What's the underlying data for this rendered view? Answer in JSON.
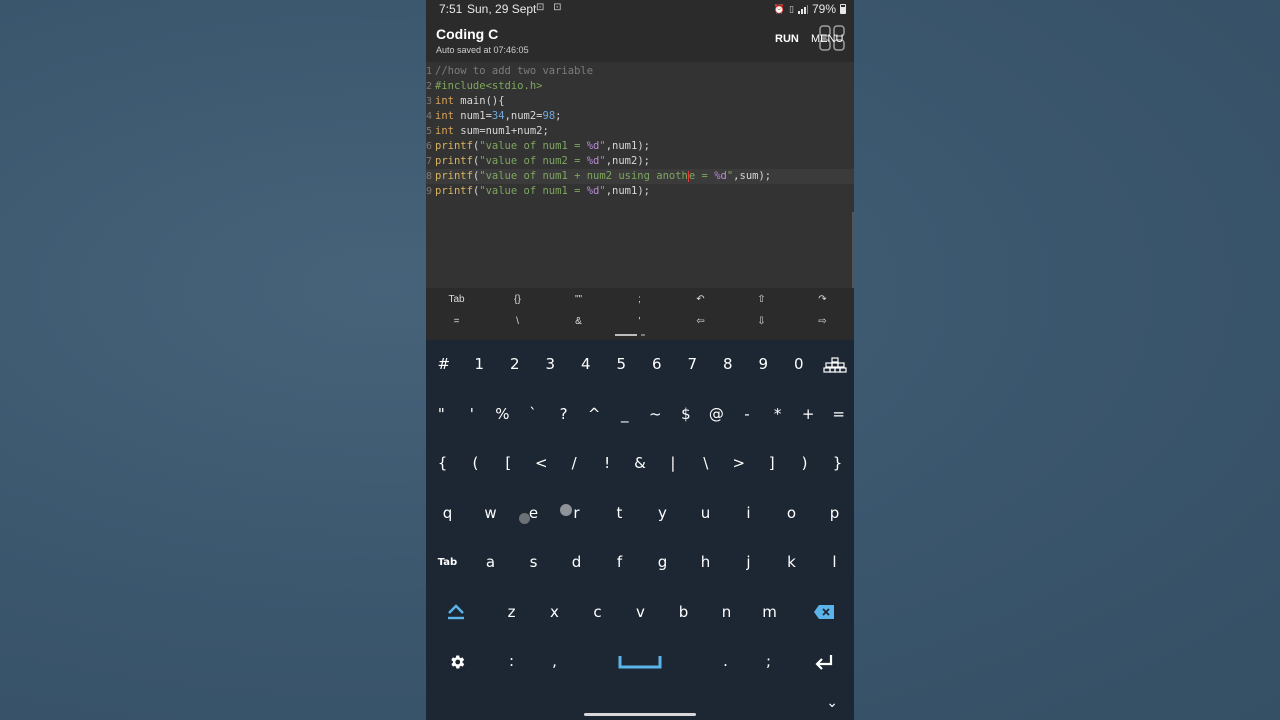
{
  "status_bar": {
    "time": "7:51",
    "date": "Sun, 29 Sept",
    "left_icons": "⊡ ⊡",
    "battery": "79%"
  },
  "app_bar": {
    "title": "Coding C",
    "subtitle": "Auto saved at 07:46:05",
    "run_label": "RUN",
    "menu_label": "MENU"
  },
  "editor": {
    "line_numbers": [
      "1",
      "2",
      "3",
      "4",
      "5",
      "6",
      "7",
      "8",
      "9"
    ],
    "lines": [
      [
        {
          "t": "//how to add two variable",
          "c": "comment"
        }
      ],
      [
        {
          "t": "#include<stdio.h>",
          "c": "pre"
        }
      ],
      [
        {
          "t": "int",
          "c": "kw"
        },
        {
          "t": " main(){",
          "c": "plain"
        }
      ],
      [
        {
          "t": "int",
          "c": "kw"
        },
        {
          "t": " num1=",
          "c": "plain"
        },
        {
          "t": "34",
          "c": "num"
        },
        {
          "t": ",num2=",
          "c": "plain"
        },
        {
          "t": "98",
          "c": "num"
        },
        {
          "t": ";",
          "c": "plain"
        }
      ],
      [
        {
          "t": "int",
          "c": "kw"
        },
        {
          "t": " sum=num1+num2;",
          "c": "plain"
        }
      ],
      [
        {
          "t": "printf",
          "c": "fn"
        },
        {
          "t": "(",
          "c": "plain"
        },
        {
          "t": "\"value of num1 = ",
          "c": "str"
        },
        {
          "t": "%d",
          "c": "fmt"
        },
        {
          "t": "\"",
          "c": "str"
        },
        {
          "t": ",num1);",
          "c": "plain"
        }
      ],
      [
        {
          "t": "printf",
          "c": "fn"
        },
        {
          "t": "(",
          "c": "plain"
        },
        {
          "t": "\"value of num2 = ",
          "c": "str"
        },
        {
          "t": "%d",
          "c": "fmt"
        },
        {
          "t": "\"",
          "c": "str"
        },
        {
          "t": ",num2);",
          "c": "plain"
        }
      ],
      [
        {
          "t": "printf",
          "c": "fn"
        },
        {
          "t": "(",
          "c": "plain"
        },
        {
          "t": "\"value of num1 + num2 using anoth",
          "c": "str"
        },
        {
          "t": "|",
          "c": "cursor"
        },
        {
          "t": "e = ",
          "c": "str"
        },
        {
          "t": "%d",
          "c": "fmt"
        },
        {
          "t": "\"",
          "c": "str"
        },
        {
          "t": ",sum);",
          "c": "plain"
        }
      ],
      [
        {
          "t": "printf",
          "c": "fn"
        },
        {
          "t": "(",
          "c": "plain"
        },
        {
          "t": "\"value of num1 = ",
          "c": "str"
        },
        {
          "t": "%d",
          "c": "fmt"
        },
        {
          "t": "\"",
          "c": "str"
        },
        {
          "t": ",num1);",
          "c": "plain"
        }
      ]
    ],
    "active_line": 8
  },
  "extra_keys": {
    "row1": [
      "Tab",
      "{}",
      "\"\"",
      ";",
      "↶",
      "⇧",
      "↷"
    ],
    "row2": [
      "=",
      "\\",
      "&",
      "'",
      "⇦",
      "⇩",
      "⇨"
    ]
  },
  "keyboard": {
    "row1": [
      "#",
      "1",
      "2",
      "3",
      "4",
      "5",
      "6",
      "7",
      "8",
      "9",
      "0"
    ],
    "row2": [
      "\"",
      "'",
      "%",
      "`",
      "?",
      "^",
      "_",
      "~",
      "$",
      "@",
      "-",
      "*",
      "+",
      "="
    ],
    "row3": [
      "{",
      "(",
      "[",
      "<",
      "/",
      "!",
      "&",
      "|",
      "\\",
      ">",
      "]",
      ")",
      "}"
    ],
    "row4": [
      "q",
      "w",
      "e",
      "r",
      "t",
      "y",
      "u",
      "i",
      "o",
      "p"
    ],
    "row5": [
      "Tab",
      "a",
      "s",
      "d",
      "f",
      "g",
      "h",
      "j",
      "k",
      "l"
    ],
    "row6": [
      "z",
      "x",
      "c",
      "v",
      "b",
      "n",
      "m"
    ],
    "row7": [
      ":",
      ",",
      ".",
      ";"
    ]
  },
  "colors": {
    "accent": "#5ab4ea",
    "keyboard_bg": "#1d2733",
    "editor_bg": "#333333"
  }
}
